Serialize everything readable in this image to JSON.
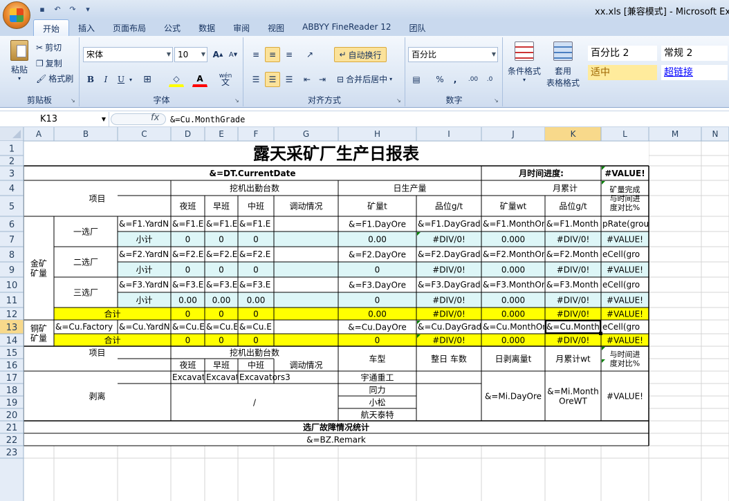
{
  "window": {
    "title": "xx.xls  [兼容模式] - Microsoft Excel"
  },
  "tabs": [
    "开始",
    "插入",
    "页面布局",
    "公式",
    "数据",
    "审阅",
    "视图",
    "ABBYY FineReader 12",
    "团队"
  ],
  "clipboard": {
    "paste": "粘贴",
    "cut": "剪切",
    "copy": "复制",
    "format_painter": "格式刷",
    "label": "剪贴板"
  },
  "font": {
    "name": "宋体",
    "size": "10",
    "grow": "A",
    "shrink": "A",
    "bold": "B",
    "italic": "I",
    "underline": "U",
    "phonetic": "wén",
    "label": "字体"
  },
  "alignment": {
    "wrap": "自动换行",
    "merge": "合并后居中",
    "label": "对齐方式"
  },
  "number": {
    "format": "百分比",
    "percent": "%",
    "comma": ",",
    "inc_decimal": ".00",
    "dec_decimal": ".0",
    "label": "数字"
  },
  "styles": {
    "conditional": "条件格式",
    "table": "套用",
    "table2": "表格格式",
    "percent2": "百分比 2",
    "normal2": "常规 2",
    "neutral": "适中",
    "hyperlink": "超链接"
  },
  "formula_bar": {
    "cell": "K13",
    "fx": "fx",
    "formula": "&=Cu.MonthGrade"
  },
  "colors": {
    "yellow": "#ffff00",
    "cyan": "#ddf6f7",
    "selected_header": "#f8d98b",
    "header_bg": "#e4ecf7"
  },
  "columns": [
    "A",
    "B",
    "C",
    "D",
    "E",
    "F",
    "G",
    "H",
    "I",
    "J",
    "K",
    "L",
    "M",
    "N"
  ],
  "rows": [
    "1",
    "2",
    "3",
    "4",
    "5",
    "6",
    "7",
    "8",
    "9",
    "10",
    "11",
    "12",
    "13",
    "14",
    "15",
    "16",
    "17",
    "18",
    "19",
    "20",
    "21",
    "22",
    "23"
  ],
  "sheet": {
    "title": "露天采矿厂生产日报表",
    "current_date": "&=DT.CurrentDate",
    "month_progress": "月时间进度:",
    "value_err": "#VALUE!",
    "div_err": "#DIV/0!",
    "item": "项目",
    "excavator_attendance": "挖机出勤台数",
    "daily_production": "日生产量",
    "monthly_total": "月累计",
    "night": "夜班",
    "morning": "早班",
    "middle": "中班",
    "dispatch": "调动情况",
    "ore_t": "矿量t",
    "grade_gt": "品位g/t",
    "ore_wt": "矿量wt",
    "grade_gt2": "品位g/t",
    "completion": "矿量完成与时间进度对比%",
    "gold_ore": "金矿矿量",
    "copper_ore": "铜矿矿量",
    "plant1": "一选厂",
    "plant2": "二选厂",
    "plant3": "三选厂",
    "subtotal": "小计",
    "total": "合计",
    "f1_yard": "&=F1.YardN",
    "f1_e": "&=F1.E",
    "f1_dayore": "&=F1.DayOre",
    "f1_daygrad": "&=F1.DayGrad",
    "f1_monthor": "&=F1.MonthOr",
    "f1_month": "&=F1.Month",
    "f1_rate": "pRate(grou",
    "f2_yard": "&=F2.YardN",
    "f2_e": "&=F2.E",
    "f2_dayore": "&=F2.DayOre",
    "f2_daygrad": "&=F2.DayGrad",
    "f2_monthor": "&=F2.MonthOr",
    "f2_month": "&=F2.Month",
    "cell_gro": "eCell(gro",
    "f3_yard": "&=F3.YardN",
    "f3_e": "&=F3.E",
    "f3_dayore": "&=F3.DayOre",
    "f3_daygrad": "&=F3.DayGrad",
    "f3_monthor": "&=F3.MonthOr",
    "f3_month": "&=F3.Month",
    "cu_factory": "&=Cu.Factory",
    "cu_yard": "&=Cu.YardN",
    "cu_e": "&=Cu.E",
    "cu_dayore": "&=Cu.DayOre",
    "cu_daygrad": "&=Cu.DayGrad",
    "cu_monthor": "&=Cu.MonthOr",
    "cu_month": "&=Cu.Month",
    "zero": "0",
    "zero2": "0.00",
    "zero3": "0.000",
    "vehicle_type": "车型",
    "full_vehicles": "整日   车数",
    "daily_strip": "日剥离量t",
    "monthly_wt": "月累计wt",
    "vs_progress": "与时间进度对比%",
    "stripping": "剥离",
    "exc1": "Excavat",
    "exc2": "Excavat",
    "exc3": "Excavators3",
    "slash": "/",
    "v1": "宇通重工",
    "v2": "同力",
    "v3": "小松",
    "v4": "航天泰特",
    "mi_day": "&=Mi.DayOre",
    "mi_month1": "&=Mi.Month",
    "mi_month2": "OreWT",
    "fault_stats": "选厂故障情况统计",
    "remark": "&=BZ.Remark"
  }
}
